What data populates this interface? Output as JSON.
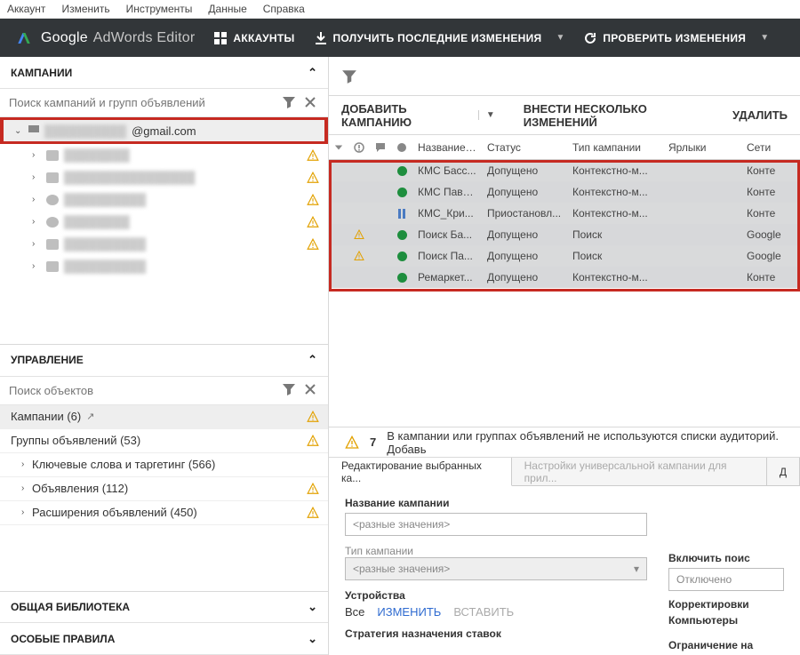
{
  "menu": {
    "items": [
      "Аккаунт",
      "Изменить",
      "Инструменты",
      "Данные",
      "Справка"
    ]
  },
  "brand": {
    "google": "Google",
    "product": "AdWords Editor"
  },
  "toolbar": {
    "accounts": "АККАУНТЫ",
    "get_changes": "ПОЛУЧИТЬ ПОСЛЕДНИЕ ИЗМЕНЕНИЯ",
    "check_changes": "ПРОВЕРИТЬ ИЗМЕНЕНИЯ"
  },
  "left": {
    "campaigns_hd": "КАМПАНИИ",
    "search_placeholder": "Поиск кампаний и групп объявлений",
    "account_suffix": "@gmail.com",
    "mgmt_hd": "УПРАВЛЕНИЕ",
    "mgmt_search_placeholder": "Поиск объектов",
    "items": [
      {
        "label": "Кампании (6)",
        "ext": true
      },
      {
        "label": "Группы объявлений (53)"
      },
      {
        "label": "Ключевые слова и таргетинг (566)",
        "chev": true
      },
      {
        "label": "Объявления (112)",
        "chev": true
      },
      {
        "label": "Расширения объявлений (450)",
        "chev": true
      }
    ],
    "shared_hd": "ОБЩАЯ БИБЛИОТЕКА",
    "rules_hd": "ОСОБЫЕ ПРАВИЛА"
  },
  "right": {
    "actions": {
      "add": "ДОБАВИТЬ КАМПАНИЮ",
      "bulk": "ВНЕСТИ НЕСКОЛЬКО ИЗМЕНЕНИЙ",
      "del": "УДАЛИТЬ"
    },
    "cols": {
      "name": "Название ...",
      "status": "Статус",
      "type": "Тип кампании",
      "labels": "Ярлыки",
      "net": "Сети"
    },
    "rows": [
      {
        "warn": false,
        "dot": "green",
        "name": "КМС Басс...",
        "status": "Допущено",
        "type": "Контекстно-м...",
        "net": "Конте"
      },
      {
        "warn": false,
        "dot": "green",
        "name": "КМС Пави...",
        "status": "Допущено",
        "type": "Контекстно-м...",
        "net": "Конте"
      },
      {
        "warn": false,
        "dot": "pause",
        "name": "КМС_Кри...",
        "status": "Приостановл...",
        "type": "Контекстно-м...",
        "net": "Конте"
      },
      {
        "warn": true,
        "dot": "green",
        "name": "Поиск Ба...",
        "status": "Допущено",
        "type": "Поиск",
        "net": "Google"
      },
      {
        "warn": true,
        "dot": "green",
        "name": "Поиск Па...",
        "status": "Допущено",
        "type": "Поиск",
        "net": "Google"
      },
      {
        "warn": false,
        "dot": "green",
        "name": "Ремаркет...",
        "status": "Допущено",
        "type": "Контекстно-м...",
        "net": "Конте"
      }
    ],
    "warnline": {
      "count": "7",
      "text": "В кампании или группах объявлений не используются списки аудиторий. Добавь"
    },
    "tabs": {
      "edit": "Редактирование выбранных ка...",
      "uac": "Настройки универсальной кампании для прил...",
      "d": "Д"
    },
    "form": {
      "name_label": "Название кампании",
      "name_value": "<разные значения>",
      "type_label": "Тип кампании",
      "type_value": "<разные значения>",
      "devices_label": "Устройства",
      "devices_all": "Все",
      "devices_change": "ИЗМЕНИТЬ",
      "devices_insert": "ВСТАВИТЬ",
      "bid_label": "Стратегия назначения ставок",
      "include_search_label": "Включить поис",
      "include_search_value": "Отключено",
      "adjust_label": "Корректировки",
      "computers_label": "Компьютеры",
      "limit_label": "Ограничение на"
    }
  }
}
